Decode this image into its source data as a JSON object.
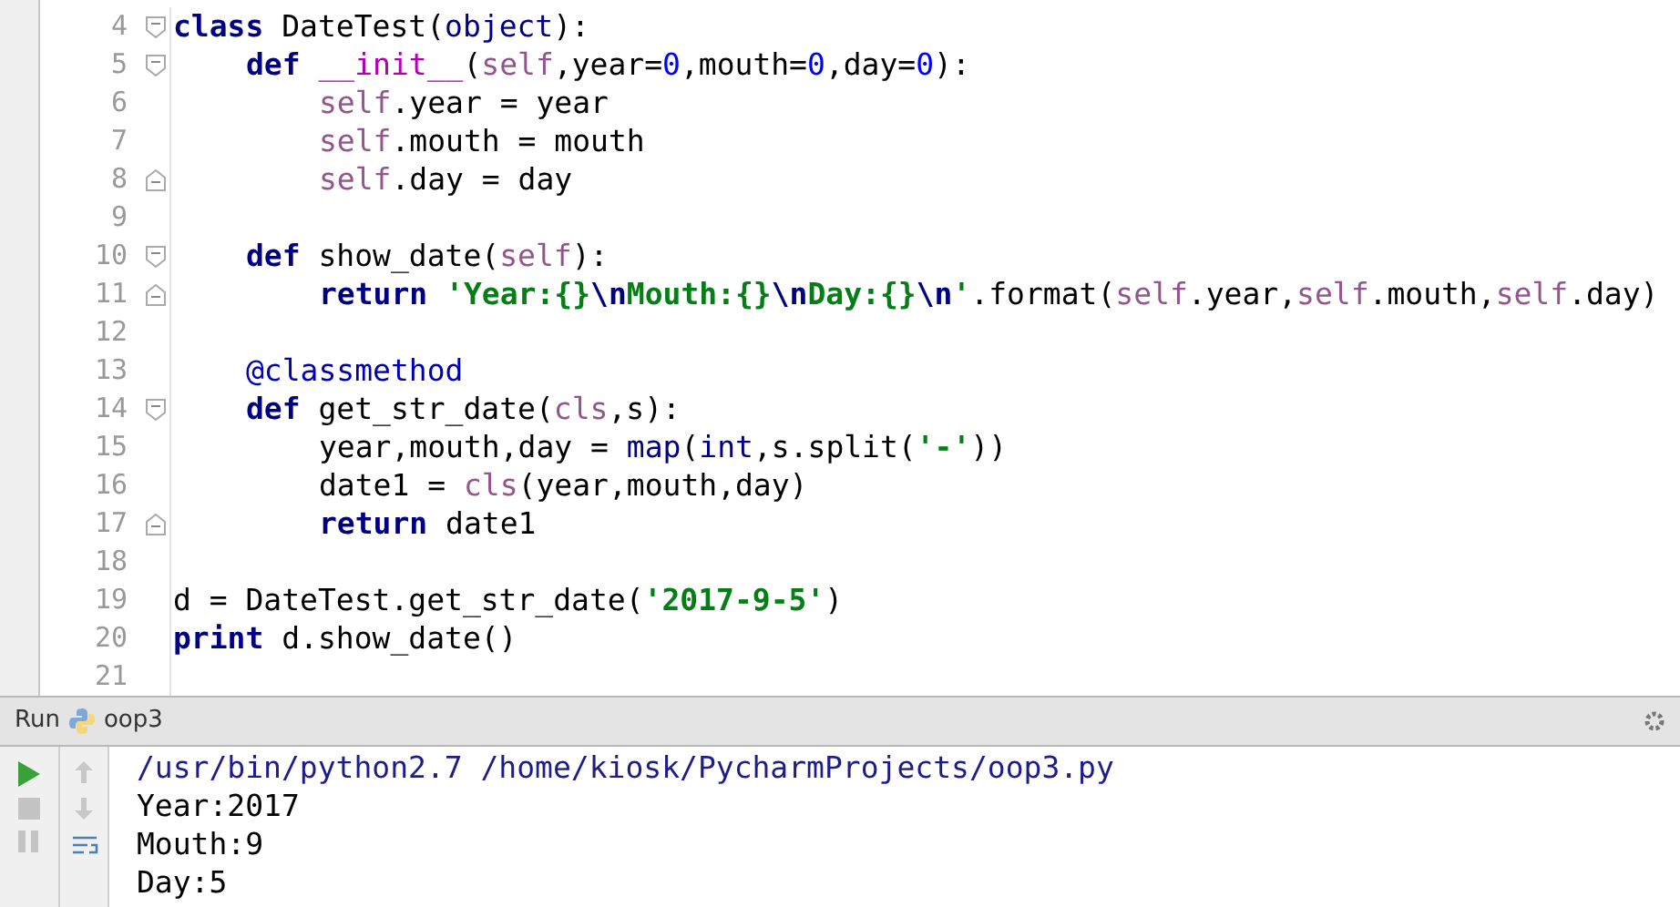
{
  "editor": {
    "lines": [
      {
        "number": "4",
        "kind": "top",
        "fold_start": true,
        "fold_end": false,
        "tokens": [
          {
            "kind": "kw",
            "text": "class"
          },
          {
            "kind": "plain",
            "text": " DateTest("
          },
          {
            "kind": "builtin",
            "text": "object"
          },
          {
            "kind": "plain",
            "text": "):"
          }
        ]
      },
      {
        "number": "5",
        "kind": "method",
        "fold_start": true,
        "fold_end": false,
        "tokens": [
          {
            "kind": "kw",
            "text": "def"
          },
          {
            "kind": "magic",
            "text": " __init__"
          },
          {
            "kind": "plain",
            "text": "("
          },
          {
            "kind": "self",
            "text": "self"
          },
          {
            "kind": "plain",
            "text": ",year="
          },
          {
            "kind": "num",
            "text": "0"
          },
          {
            "kind": "plain",
            "text": ",mouth="
          },
          {
            "kind": "num",
            "text": "0"
          },
          {
            "kind": "plain",
            "text": ",day="
          },
          {
            "kind": "num",
            "text": "0"
          },
          {
            "kind": "plain",
            "text": "):"
          }
        ]
      },
      {
        "number": "6",
        "kind": "body",
        "fold_start": false,
        "fold_end": false,
        "tokens": [
          {
            "kind": "self",
            "text": "self"
          },
          {
            "kind": "plain",
            "text": ".year = year"
          }
        ]
      },
      {
        "number": "7",
        "kind": "body",
        "fold_start": false,
        "fold_end": false,
        "tokens": [
          {
            "kind": "self",
            "text": "self"
          },
          {
            "kind": "plain",
            "text": ".mouth = mouth"
          }
        ]
      },
      {
        "number": "8",
        "kind": "body",
        "fold_start": false,
        "fold_end": true,
        "tokens": [
          {
            "kind": "self",
            "text": "self"
          },
          {
            "kind": "plain",
            "text": ".day = day"
          }
        ]
      },
      {
        "number": "9",
        "kind": "top",
        "fold_start": false,
        "fold_end": false
      },
      {
        "number": "10",
        "kind": "method",
        "fold_start": true,
        "fold_end": false,
        "tokens": [
          {
            "kind": "kw",
            "text": "def"
          },
          {
            "kind": "plain",
            "text": " show_date("
          },
          {
            "kind": "self",
            "text": "self"
          },
          {
            "kind": "plain",
            "text": "):"
          }
        ]
      },
      {
        "number": "11",
        "kind": "body",
        "fold_start": false,
        "fold_end": true,
        "tokens": [
          {
            "kind": "kw",
            "text": "return"
          },
          {
            "kind": "str",
            "text": " 'Year:{}"
          },
          {
            "kind": "esc",
            "text": "\\n"
          },
          {
            "kind": "str",
            "text": "Mouth:{}"
          },
          {
            "kind": "esc",
            "text": "\\n"
          },
          {
            "kind": "str",
            "text": "Day:{}"
          },
          {
            "kind": "esc",
            "text": "\\n"
          },
          {
            "kind": "str",
            "text": "'"
          },
          {
            "kind": "plain",
            "text": ".format("
          },
          {
            "kind": "self",
            "text": "self"
          },
          {
            "kind": "plain",
            "text": ".year,"
          },
          {
            "kind": "self",
            "text": "self"
          },
          {
            "kind": "plain",
            "text": ".mouth,"
          },
          {
            "kind": "self",
            "text": "self"
          },
          {
            "kind": "plain",
            "text": ".day)"
          }
        ]
      },
      {
        "number": "12",
        "kind": "top",
        "fold_start": false,
        "fold_end": false
      },
      {
        "number": "13",
        "kind": "method",
        "fold_start": false,
        "fold_end": false,
        "tokens": [
          {
            "kind": "deco",
            "text": "@classmethod"
          }
        ]
      },
      {
        "number": "14",
        "kind": "method",
        "fold_start": true,
        "fold_end": false,
        "tokens": [
          {
            "kind": "kw",
            "text": "def"
          },
          {
            "kind": "plain",
            "text": " get_str_date("
          },
          {
            "kind": "self",
            "text": "cls"
          },
          {
            "kind": "plain",
            "text": ",s):"
          }
        ]
      },
      {
        "number": "15",
        "kind": "body",
        "fold_start": false,
        "fold_end": false,
        "tokens": [
          {
            "kind": "plain",
            "text": "year,mouth,day = "
          },
          {
            "kind": "builtin",
            "text": "map"
          },
          {
            "kind": "plain",
            "text": "("
          },
          {
            "kind": "builtin",
            "text": "int"
          },
          {
            "kind": "plain",
            "text": ",s.split("
          },
          {
            "kind": "str",
            "text": "'-'"
          },
          {
            "kind": "plain",
            "text": "))"
          }
        ]
      },
      {
        "number": "16",
        "kind": "body",
        "fold_start": false,
        "fold_end": false,
        "tokens": [
          {
            "kind": "plain",
            "text": "date1 = "
          },
          {
            "kind": "self",
            "text": "cls"
          },
          {
            "kind": "plain",
            "text": "(year,mouth,day)"
          }
        ]
      },
      {
        "number": "17",
        "kind": "body",
        "fold_start": false,
        "fold_end": true,
        "tokens": [
          {
            "kind": "kw",
            "text": "return"
          },
          {
            "kind": "plain",
            "text": " date1"
          }
        ]
      },
      {
        "number": "18",
        "kind": "top",
        "fold_start": false,
        "fold_end": false
      },
      {
        "number": "19",
        "kind": "top",
        "fold_start": false,
        "fold_end": false,
        "tokens": [
          {
            "kind": "plain",
            "text": "d = DateTest.get_str_date("
          },
          {
            "kind": "str",
            "text": "'2017-9-5'"
          },
          {
            "kind": "plain",
            "text": ")"
          }
        ]
      },
      {
        "number": "20",
        "kind": "top",
        "fold_start": false,
        "fold_end": false,
        "tokens": [
          {
            "kind": "kw",
            "text": "print"
          },
          {
            "kind": "plain",
            "text": " d.show_date()"
          }
        ]
      },
      {
        "number": "21",
        "kind": "top",
        "fold_start": false,
        "fold_end": false
      }
    ]
  },
  "run_panel": {
    "label": "Run",
    "config": "oop3",
    "output": [
      {
        "kind": "command",
        "text": "/usr/bin/python2.7 /home/kiosk/PycharmProjects/oop3.py"
      },
      {
        "kind": "stdout",
        "text": "Year:2017"
      },
      {
        "kind": "stdout",
        "text": "Mouth:9"
      },
      {
        "kind": "stdout",
        "text": "Day:5"
      }
    ]
  }
}
